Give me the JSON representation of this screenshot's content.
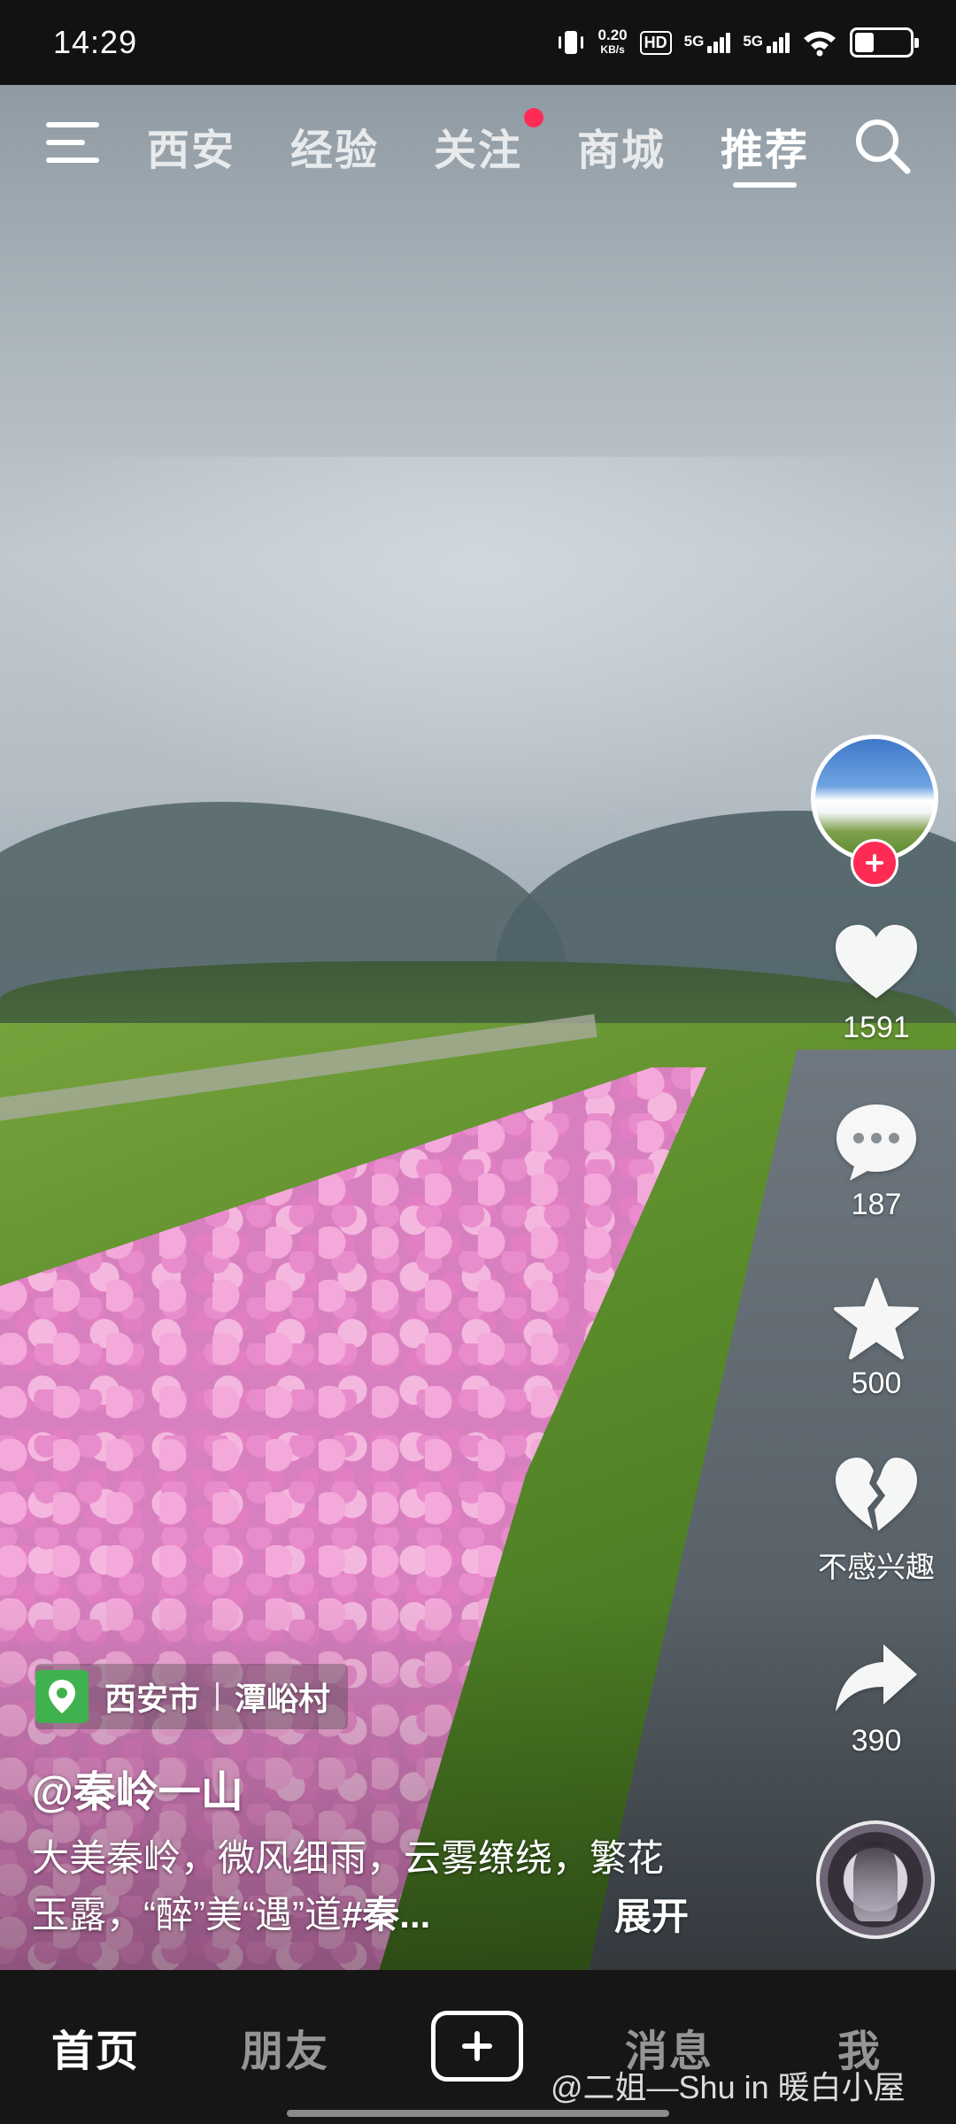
{
  "status_bar": {
    "time": "14:29",
    "net_speed_value": "0.20",
    "net_speed_unit": "KB/s",
    "hd_label": "HD",
    "signal1_label": "5G",
    "signal2_label": "5G",
    "battery_level": 0.35,
    "icons": [
      "vibrate-icon",
      "hd-icon",
      "signal-icon",
      "signal-icon",
      "wifi-icon",
      "battery-icon"
    ]
  },
  "top_nav": {
    "tabs": [
      {
        "label": "西安",
        "active": false
      },
      {
        "label": "经验",
        "active": false
      },
      {
        "label": "关注",
        "active": false,
        "badge": true
      },
      {
        "label": "商城",
        "active": false
      },
      {
        "label": "推荐",
        "active": true
      }
    ],
    "icons": [
      "menu-icon",
      "search-icon"
    ]
  },
  "actions": {
    "like_count": "1591",
    "comment_count": "187",
    "favorite_count": "500",
    "not_interested_label": "不感兴趣",
    "share_count": "390"
  },
  "post": {
    "location_city": "西安市",
    "location_place": "潭峪村",
    "author": "@秦岭一山",
    "caption_line1": "大美秦岭，微风细雨，云雾缭绕，繁花",
    "caption_line2": "玉露，“醉”美“遇”道",
    "caption_tag": "#秦...",
    "expand_label": "展开"
  },
  "bottom_nav": {
    "items": [
      {
        "label": "首页",
        "active": true
      },
      {
        "label": "朋友",
        "active": false
      },
      {
        "label": "消息",
        "active": false
      },
      {
        "label": "我",
        "active": false
      }
    ],
    "watermark": "@二姐—Shu in 暖白小屋"
  },
  "colors": {
    "accent_red": "#fe2c55",
    "location_green": "#3fb24f",
    "nav_background": "#161616",
    "status_background": "#121212"
  }
}
